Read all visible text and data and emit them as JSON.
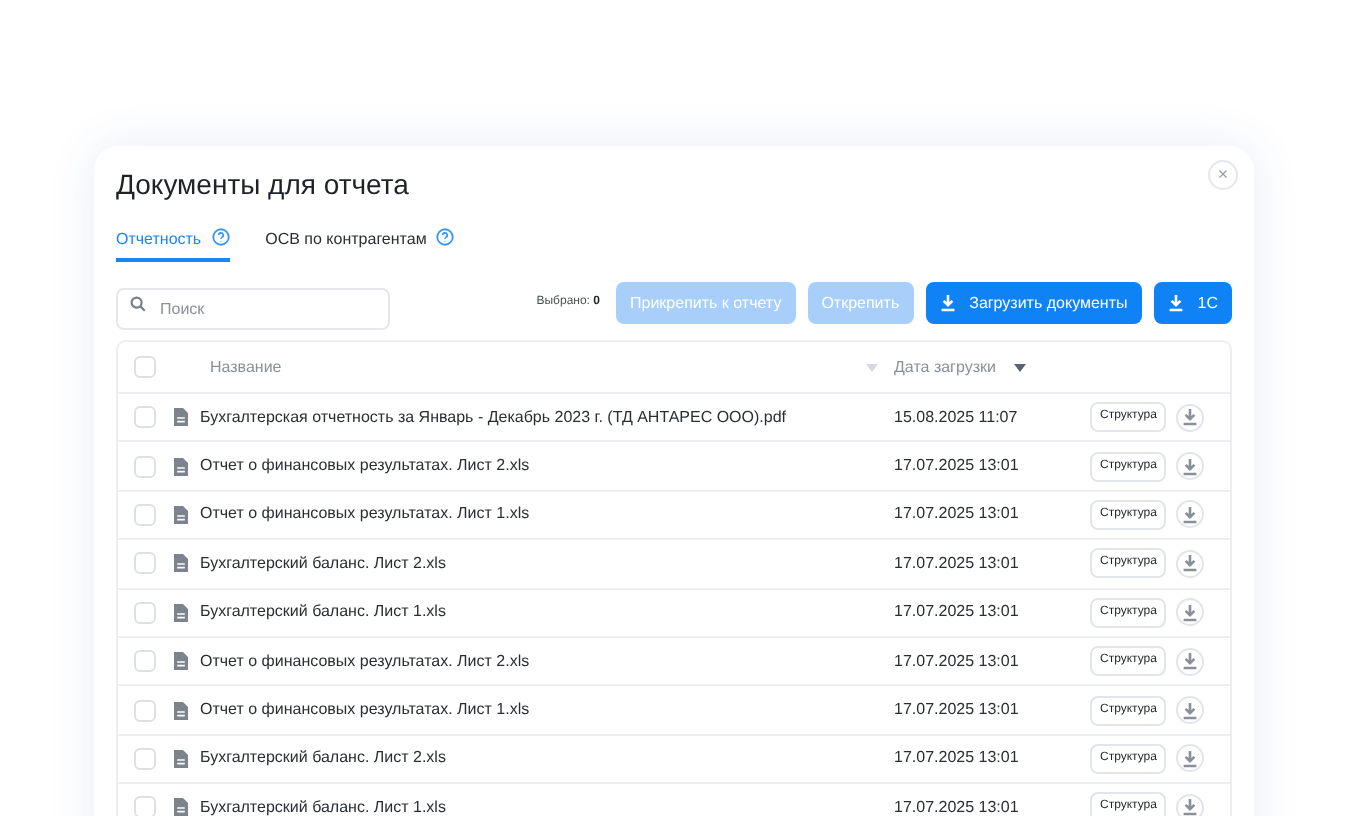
{
  "dialog": {
    "title": "Документы для отчета",
    "close": "×"
  },
  "tabs": [
    {
      "label": "Отчетность",
      "selected": true
    },
    {
      "label": "ОСВ по контрагентам",
      "selected": false
    }
  ],
  "search": {
    "placeholder": "Поиск"
  },
  "selection": {
    "label": "Выбрано:",
    "count": "0"
  },
  "buttons": [
    {
      "label": "Прикрепить к отчету",
      "disabled": true,
      "icon": false
    },
    {
      "label": "Открепить",
      "disabled": true,
      "icon": false
    },
    {
      "label": "Загрузить документы",
      "disabled": false,
      "icon": true
    },
    {
      "label": "1С",
      "disabled": false,
      "icon": true
    }
  ],
  "table": {
    "select_all_checked": false,
    "columns": [
      {
        "label": "Название",
        "sorted": false
      },
      {
        "label": "Дата загрузки",
        "sorted": true
      }
    ],
    "rows": [
      {
        "name": "Бухгалтерская отчетность за Январь - Декабрь 2023 г. (ТД АНТАРЕС ООО).pdf",
        "date": "15.08.2025 11:07",
        "action": "Структура",
        "checked": false
      },
      {
        "name": "Отчет о финансовых результатах. Лист 2.xls",
        "date": "17.07.2025 13:01",
        "action": "Структура",
        "checked": false
      },
      {
        "name": "Отчет о финансовых результатах. Лист 1.xls",
        "date": "17.07.2025 13:01",
        "action": "Структура",
        "checked": false
      },
      {
        "name": "Бухгалтерский баланс. Лист 2.xls",
        "date": "17.07.2025 13:01",
        "action": "Структура",
        "checked": false
      },
      {
        "name": "Бухгалтерский баланс. Лист 1.xls",
        "date": "17.07.2025 13:01",
        "action": "Структура",
        "checked": false
      },
      {
        "name": "Отчет о финансовых результатах. Лист 2.xls",
        "date": "17.07.2025 13:01",
        "action": "Структура",
        "checked": false
      },
      {
        "name": "Отчет о финансовых результатах. Лист 1.xls",
        "date": "17.07.2025 13:01",
        "action": "Структура",
        "checked": false
      },
      {
        "name": "Бухгалтерский баланс. Лист 2.xls",
        "date": "17.07.2025 13:01",
        "action": "Структура",
        "checked": false
      },
      {
        "name": "Бухгалтерский баланс. Лист 1.xls",
        "date": "17.07.2025 13:01",
        "action": "Структура",
        "checked": false
      }
    ]
  }
}
